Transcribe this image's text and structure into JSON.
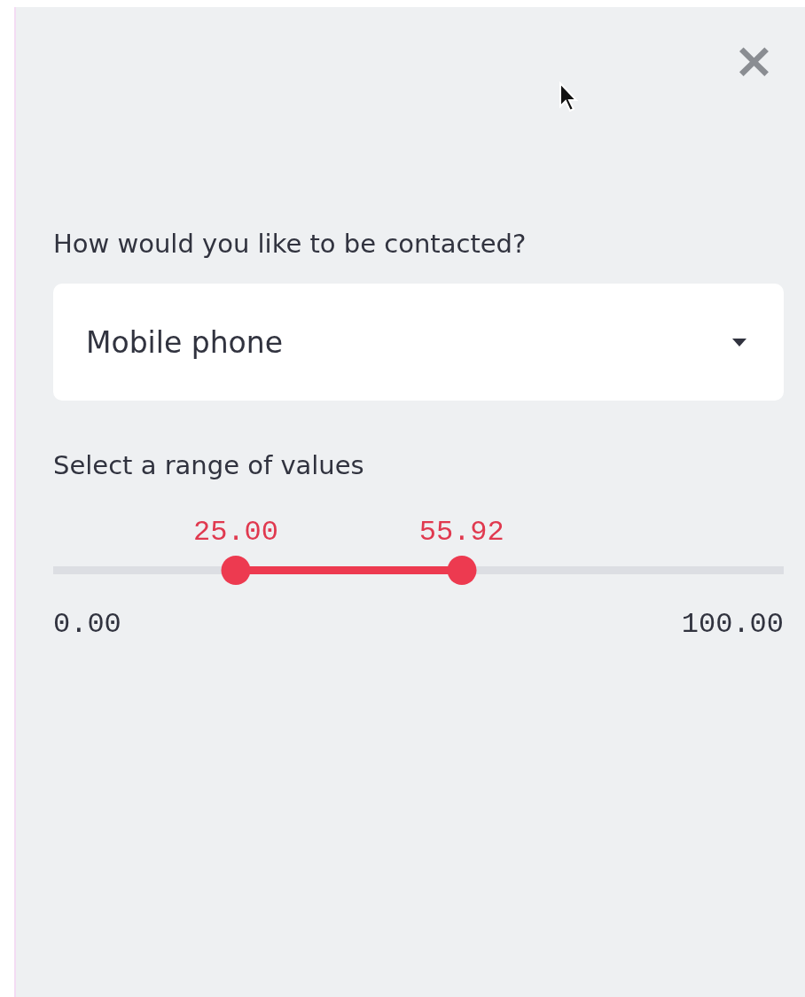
{
  "sidebar": {
    "close": {
      "label": "×"
    },
    "select": {
      "label": "How would you like to be contacted?",
      "value": "Mobile phone"
    },
    "range_slider": {
      "label": "Select a range of values",
      "min": "0.00",
      "max": "100.00",
      "thumbs": [
        {
          "level": 0.25,
          "reading": "25.00"
        },
        {
          "level": 0.5592,
          "reading": "55.92"
        }
      ]
    }
  }
}
